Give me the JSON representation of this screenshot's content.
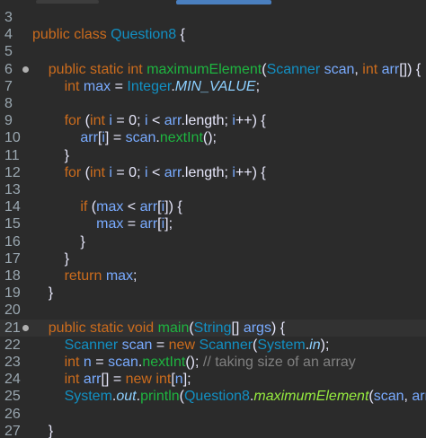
{
  "editor": {
    "lines": [
      {
        "n": "3",
        "code": []
      },
      {
        "n": "4",
        "code": [
          [
            "kw",
            "public"
          ],
          [
            "pl",
            " "
          ],
          [
            "kw",
            "class"
          ],
          [
            "pl",
            " "
          ],
          [
            "ty",
            "Question8"
          ],
          [
            "pl",
            " {"
          ]
        ]
      },
      {
        "n": "5",
        "code": []
      },
      {
        "n": "6",
        "marker": true,
        "code": [
          [
            "pl",
            "    "
          ],
          [
            "kw",
            "public"
          ],
          [
            "pl",
            " "
          ],
          [
            "kw",
            "static"
          ],
          [
            "pl",
            " "
          ],
          [
            "kw",
            "int"
          ],
          [
            "pl",
            " "
          ],
          [
            "fn",
            "maximumElement"
          ],
          [
            "pl",
            "("
          ],
          [
            "ty",
            "Scanner"
          ],
          [
            "pl",
            " "
          ],
          [
            "var",
            "scan"
          ],
          [
            "pl",
            ", "
          ],
          [
            "kw",
            "int"
          ],
          [
            "pl",
            " "
          ],
          [
            "var",
            "arr"
          ],
          [
            "pl",
            "[]) {"
          ]
        ]
      },
      {
        "n": "7",
        "code": [
          [
            "pl",
            "        "
          ],
          [
            "kw",
            "int"
          ],
          [
            "pl",
            " "
          ],
          [
            "var",
            "max"
          ],
          [
            "pl",
            " = "
          ],
          [
            "ty",
            "Integer"
          ],
          [
            "pl",
            "."
          ],
          [
            "fld",
            "MIN_VALUE"
          ],
          [
            "pl",
            ";"
          ]
        ]
      },
      {
        "n": "8",
        "code": []
      },
      {
        "n": "9",
        "code": [
          [
            "pl",
            "        "
          ],
          [
            "kw",
            "for"
          ],
          [
            "pl",
            " ("
          ],
          [
            "kw",
            "int"
          ],
          [
            "pl",
            " "
          ],
          [
            "var",
            "i"
          ],
          [
            "pl",
            " = 0; "
          ],
          [
            "var",
            "i"
          ],
          [
            "pl",
            " < "
          ],
          [
            "var",
            "arr"
          ],
          [
            "pl",
            ".length; "
          ],
          [
            "var",
            "i"
          ],
          [
            "pl",
            "++) {"
          ]
        ]
      },
      {
        "n": "10",
        "code": [
          [
            "pl",
            "            "
          ],
          [
            "var",
            "arr"
          ],
          [
            "pl",
            "["
          ],
          [
            "var",
            "i"
          ],
          [
            "pl",
            "] = "
          ],
          [
            "var",
            "scan"
          ],
          [
            "pl",
            "."
          ],
          [
            "fn",
            "nextInt"
          ],
          [
            "pl",
            "();"
          ]
        ]
      },
      {
        "n": "11",
        "code": [
          [
            "pl",
            "        }"
          ]
        ]
      },
      {
        "n": "12",
        "code": [
          [
            "pl",
            "        "
          ],
          [
            "kw",
            "for"
          ],
          [
            "pl",
            " ("
          ],
          [
            "kw",
            "int"
          ],
          [
            "pl",
            " "
          ],
          [
            "var",
            "i"
          ],
          [
            "pl",
            " = 0; "
          ],
          [
            "var",
            "i"
          ],
          [
            "pl",
            " < "
          ],
          [
            "var",
            "arr"
          ],
          [
            "pl",
            ".length; "
          ],
          [
            "var",
            "i"
          ],
          [
            "pl",
            "++) {"
          ]
        ]
      },
      {
        "n": "13",
        "code": []
      },
      {
        "n": "14",
        "code": [
          [
            "pl",
            "            "
          ],
          [
            "kw",
            "if"
          ],
          [
            "pl",
            " ("
          ],
          [
            "var",
            "max"
          ],
          [
            "pl",
            " < "
          ],
          [
            "var",
            "arr"
          ],
          [
            "pl",
            "["
          ],
          [
            "var",
            "i"
          ],
          [
            "pl",
            "]) {"
          ]
        ]
      },
      {
        "n": "15",
        "code": [
          [
            "pl",
            "                "
          ],
          [
            "var",
            "max"
          ],
          [
            "pl",
            " = "
          ],
          [
            "var",
            "arr"
          ],
          [
            "pl",
            "["
          ],
          [
            "var",
            "i"
          ],
          [
            "pl",
            "];"
          ]
        ]
      },
      {
        "n": "16",
        "code": [
          [
            "pl",
            "            }"
          ]
        ]
      },
      {
        "n": "17",
        "code": [
          [
            "pl",
            "        }"
          ]
        ]
      },
      {
        "n": "18",
        "code": [
          [
            "pl",
            "        "
          ],
          [
            "kw",
            "return"
          ],
          [
            "pl",
            " "
          ],
          [
            "var",
            "max"
          ],
          [
            "pl",
            ";"
          ]
        ]
      },
      {
        "n": "19",
        "code": [
          [
            "pl",
            "    }"
          ]
        ]
      },
      {
        "n": "20",
        "code": []
      },
      {
        "n": "21",
        "marker": true,
        "hl": true,
        "code": [
          [
            "pl",
            "    "
          ],
          [
            "kw",
            "public"
          ],
          [
            "pl",
            " "
          ],
          [
            "kw",
            "static"
          ],
          [
            "pl",
            " "
          ],
          [
            "kw",
            "void"
          ],
          [
            "pl",
            " "
          ],
          [
            "fn",
            "main"
          ],
          [
            "pl",
            "("
          ],
          [
            "ty",
            "String"
          ],
          [
            "pl",
            "[] "
          ],
          [
            "var",
            "args"
          ],
          [
            "pl",
            ") {"
          ]
        ]
      },
      {
        "n": "22",
        "code": [
          [
            "pl",
            "        "
          ],
          [
            "ty",
            "Scanner"
          ],
          [
            "pl",
            " "
          ],
          [
            "var",
            "scan"
          ],
          [
            "pl",
            " = "
          ],
          [
            "kw",
            "new"
          ],
          [
            "pl",
            " "
          ],
          [
            "ty",
            "Scanner"
          ],
          [
            "pl",
            "("
          ],
          [
            "ty",
            "System"
          ],
          [
            "pl",
            "."
          ],
          [
            "fld",
            "in"
          ],
          [
            "pl",
            ");"
          ]
        ]
      },
      {
        "n": "23",
        "code": [
          [
            "pl",
            "        "
          ],
          [
            "kw",
            "int"
          ],
          [
            "pl",
            " "
          ],
          [
            "var",
            "n"
          ],
          [
            "pl",
            " = "
          ],
          [
            "var",
            "scan"
          ],
          [
            "pl",
            "."
          ],
          [
            "fn",
            "nextInt"
          ],
          [
            "pl",
            "(); "
          ],
          [
            "cm",
            "// taking size of an array"
          ]
        ]
      },
      {
        "n": "24",
        "code": [
          [
            "pl",
            "        "
          ],
          [
            "kw",
            "int"
          ],
          [
            "pl",
            " "
          ],
          [
            "var",
            "arr"
          ],
          [
            "pl",
            "[] = "
          ],
          [
            "kw",
            "new"
          ],
          [
            "pl",
            " "
          ],
          [
            "kw",
            "int"
          ],
          [
            "pl",
            "["
          ],
          [
            "var",
            "n"
          ],
          [
            "pl",
            "];"
          ]
        ]
      },
      {
        "n": "25",
        "code": [
          [
            "pl",
            "        "
          ],
          [
            "ty",
            "System"
          ],
          [
            "pl",
            "."
          ],
          [
            "fld",
            "out"
          ],
          [
            "pl",
            "."
          ],
          [
            "fn",
            "println"
          ],
          [
            "pl",
            "("
          ],
          [
            "ty",
            "Question8"
          ],
          [
            "pl",
            "."
          ],
          [
            "sfn",
            "maximumElement"
          ],
          [
            "pl",
            "("
          ],
          [
            "var",
            "scan"
          ],
          [
            "pl",
            ", "
          ],
          [
            "var",
            "arr"
          ],
          [
            "pl",
            "));"
          ]
        ]
      },
      {
        "n": "26",
        "code": []
      },
      {
        "n": "27",
        "code": [
          [
            "pl",
            "    }"
          ]
        ]
      }
    ]
  }
}
